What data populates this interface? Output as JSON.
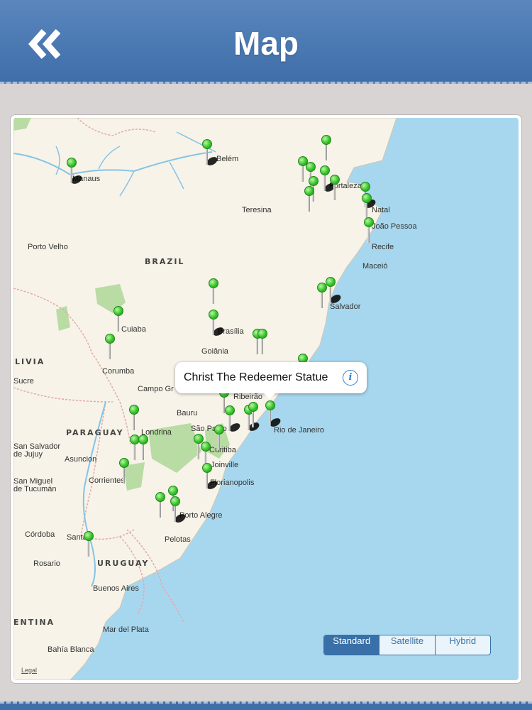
{
  "header": {
    "title": "Map",
    "back_icon": "double-chevron-left-icon"
  },
  "callout": {
    "text": "Christ The Redeemer Statue",
    "info_icon": "info-icon",
    "info_glyph": "i"
  },
  "map_type": {
    "options": [
      "Standard",
      "Satellite",
      "Hybrid"
    ],
    "selected": "Standard"
  },
  "legal": "Legal",
  "colors": {
    "header": "#4a78b2",
    "sea": "#a7d7ee",
    "land": "#f7f3e8",
    "park": "#b9dba4",
    "pin": "#37c42a",
    "segment": "#3a70a8"
  },
  "map_labels": {
    "manaus": "Manaus",
    "belem": "Belém",
    "fortaleza": "Fortaleza",
    "teresina": "Teresina",
    "natal": "Natal",
    "joao_pessoa": "João Pessoa",
    "recife": "Recife",
    "maceio": "Maceió",
    "porto_velho": "Porto Velho",
    "brazil": "BRAZIL",
    "salvador": "Salvador",
    "cuiaba": "Cuiaba",
    "brasilia": "Brasília",
    "goiania": "Goiânia",
    "bolivia": "LIVIA",
    "sucre": "Sucre",
    "corumba": "Corumba",
    "campo_grande": "Campo Gr",
    "bauru": "Bauru",
    "sao_paulo": "São Paulo",
    "rio": "Rio de Janeiro",
    "paraguay": "PARAGUAY",
    "londrina": "Londrina",
    "san_salvador": "San Salvador",
    "de_jujuy": "de Jujuy",
    "asuncion": "Asuncion",
    "curitiba": "Curitiba",
    "joinville": "Joinville",
    "corrientes": "Corrientes",
    "san_miguel": "San Miguel",
    "de_tucuman": "de Tucumán",
    "florianopolis": "Florianopolis",
    "porto_alegre": "Porto Alegre",
    "cordoba": "Córdoba",
    "santa_fe": "Santa",
    "pelotas": "Pelotas",
    "rosario": "Rosario",
    "uruguay": "URUGUAY",
    "buenos_aires": "Buenos Aires",
    "argentina": "ENTINA",
    "mar_del_plata": "Mar del Plata",
    "bahia_blanca": "Bahía Blanca",
    "ribeirao": "Ribeirão"
  }
}
